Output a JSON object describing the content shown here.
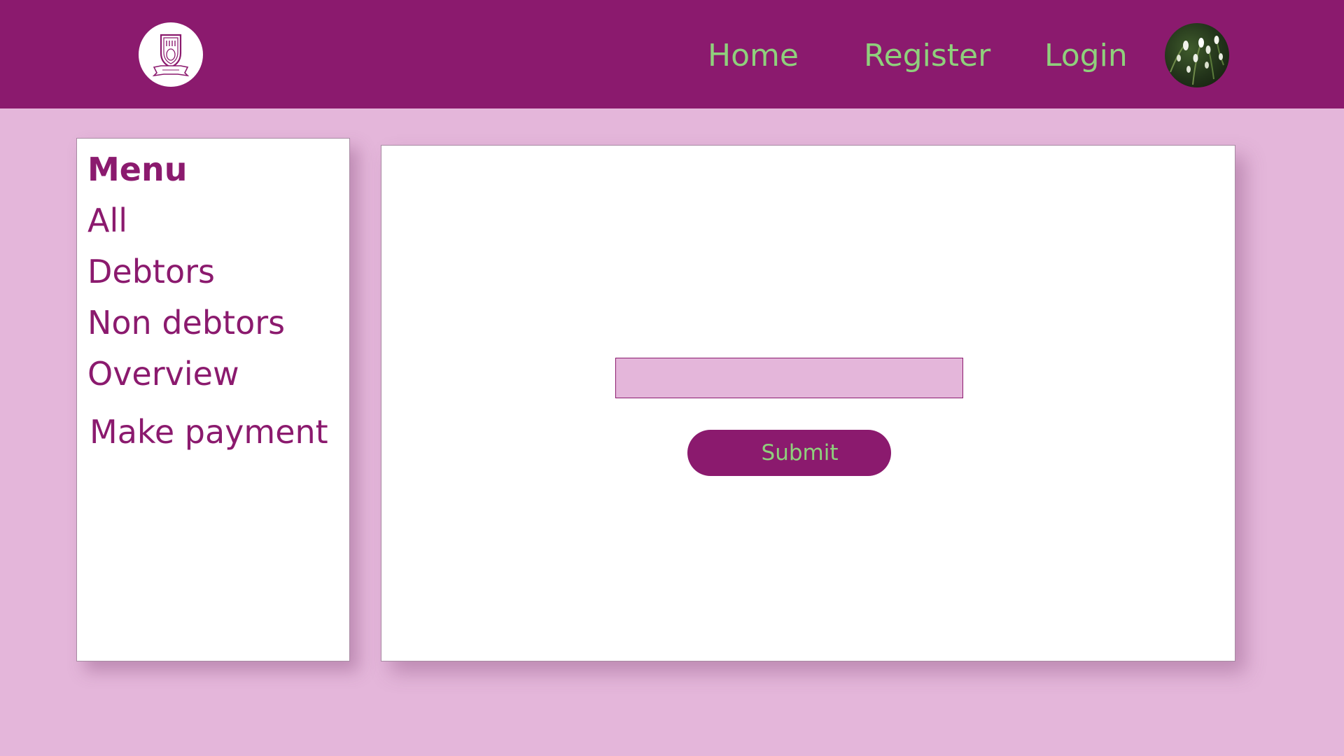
{
  "header": {
    "nav": {
      "home_label": "Home",
      "register_label": "Register",
      "login_label": "Login"
    },
    "logo_icon": "crest-logo-icon",
    "avatar_icon": "user-avatar-flowers"
  },
  "sidebar": {
    "title": "Menu",
    "items": [
      {
        "label": "All"
      },
      {
        "label": "Debtors"
      },
      {
        "label": "Non debtors"
      },
      {
        "label": "Overview"
      },
      {
        "label": "Make payment"
      }
    ]
  },
  "main": {
    "input_value": "",
    "input_placeholder": "",
    "submit_label": "Submit"
  },
  "colors": {
    "brand": "#8b1a6e",
    "accent_text": "#8fd07c",
    "page_background": "#e4b6da",
    "card_background": "#ffffff"
  }
}
